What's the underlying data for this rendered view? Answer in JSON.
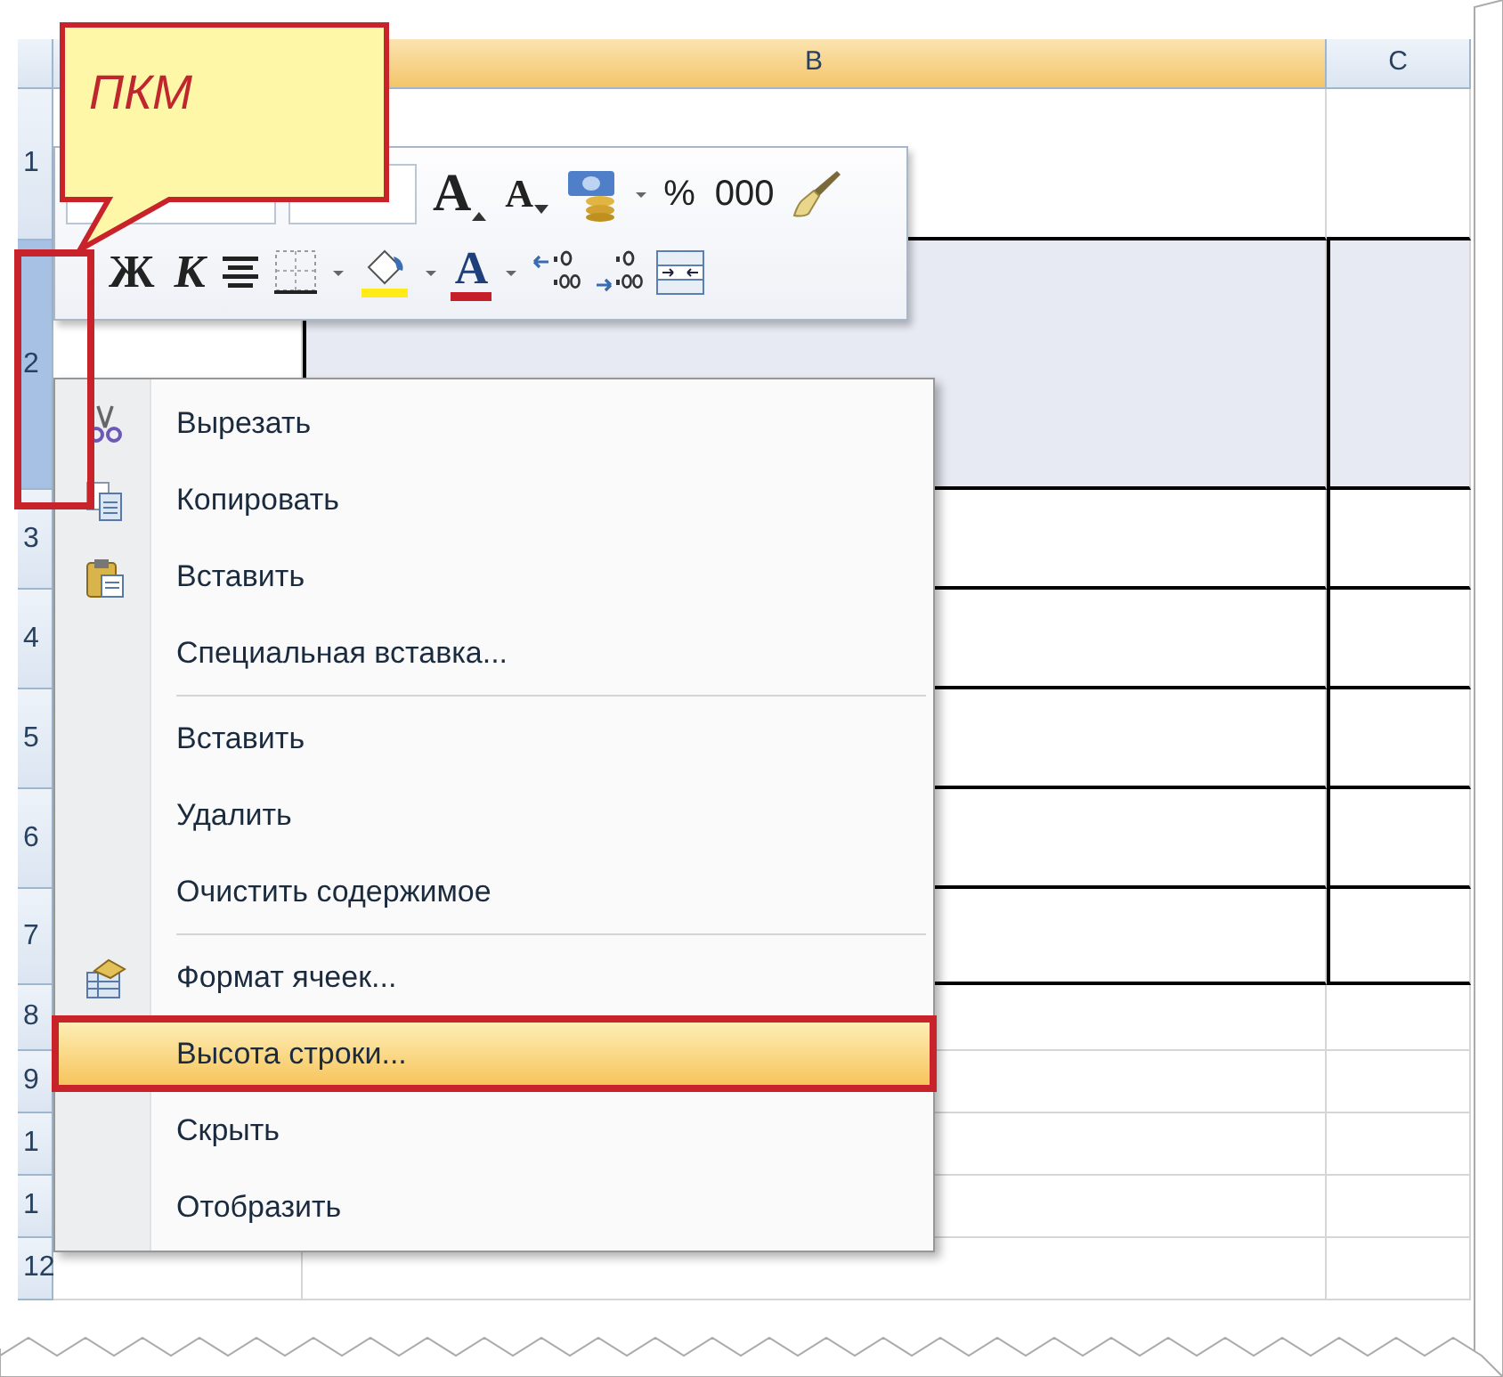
{
  "column_headers": [
    {
      "label": "B",
      "highlighted": true
    },
    {
      "label": "C",
      "highlighted": false
    }
  ],
  "rows": [
    {
      "label": "1",
      "selected": false
    },
    {
      "label": "2",
      "selected": true
    },
    {
      "label": "3",
      "selected": false
    },
    {
      "label": "4",
      "selected": false
    },
    {
      "label": "5",
      "selected": false
    },
    {
      "label": "6",
      "selected": false
    },
    {
      "label": "7",
      "selected": false
    },
    {
      "label": "8",
      "selected": false
    },
    {
      "label": "9",
      "selected": false
    },
    {
      "label": "1",
      "selected": false
    },
    {
      "label": "1",
      "selected": false
    },
    {
      "label": "12",
      "selected": false
    }
  ],
  "mini_toolbar": {
    "row_1": [
      {
        "kind": "font_field"
      },
      {
        "kind": "size_field"
      },
      {
        "kind": "grow_font",
        "label": "A"
      },
      {
        "kind": "shrink_font",
        "label": "A"
      },
      {
        "kind": "currency"
      },
      {
        "kind": "dropdown"
      },
      {
        "kind": "text",
        "label": "%"
      },
      {
        "kind": "text",
        "label": "000"
      },
      {
        "kind": "brush"
      }
    ],
    "row_2": [
      {
        "kind": "bold",
        "label": "Ж"
      },
      {
        "kind": "italic",
        "label": "К"
      },
      {
        "kind": "align"
      },
      {
        "kind": "borders"
      },
      {
        "kind": "dropdown"
      },
      {
        "kind": "fill"
      },
      {
        "kind": "dropdown"
      },
      {
        "kind": "font_color",
        "label": "A"
      },
      {
        "kind": "dropdown"
      },
      {
        "kind": "decimal_more"
      },
      {
        "kind": "decimal_less"
      },
      {
        "kind": "merge"
      }
    ]
  },
  "context_menu": {
    "items": [
      {
        "kind": "cut",
        "label": "Вырезать",
        "separator_before": false,
        "selected": false
      },
      {
        "kind": "copy",
        "label": "Копировать",
        "separator_before": false,
        "selected": false
      },
      {
        "kind": "paste",
        "label": "Вставить",
        "separator_before": false,
        "selected": false
      },
      {
        "kind": "plain",
        "label": "Специальная вставка...",
        "separator_before": false,
        "selected": false
      },
      {
        "kind": "plain",
        "label": "Вставить",
        "separator_before": true,
        "selected": false
      },
      {
        "kind": "plain",
        "label": "Удалить",
        "separator_before": false,
        "selected": false
      },
      {
        "kind": "plain",
        "label": "Очистить содержимое",
        "separator_before": false,
        "selected": false
      },
      {
        "kind": "format",
        "label": "Формат ячеек...",
        "separator_before": true,
        "selected": false
      },
      {
        "kind": "plain",
        "label": "Высота строки...",
        "separator_before": false,
        "selected": true
      },
      {
        "kind": "plain",
        "label": "Скрыть",
        "separator_before": false,
        "selected": false
      },
      {
        "kind": "plain",
        "label": "Отобразить",
        "separator_before": false,
        "selected": false
      }
    ]
  },
  "callout": {
    "text": "ПКМ"
  }
}
